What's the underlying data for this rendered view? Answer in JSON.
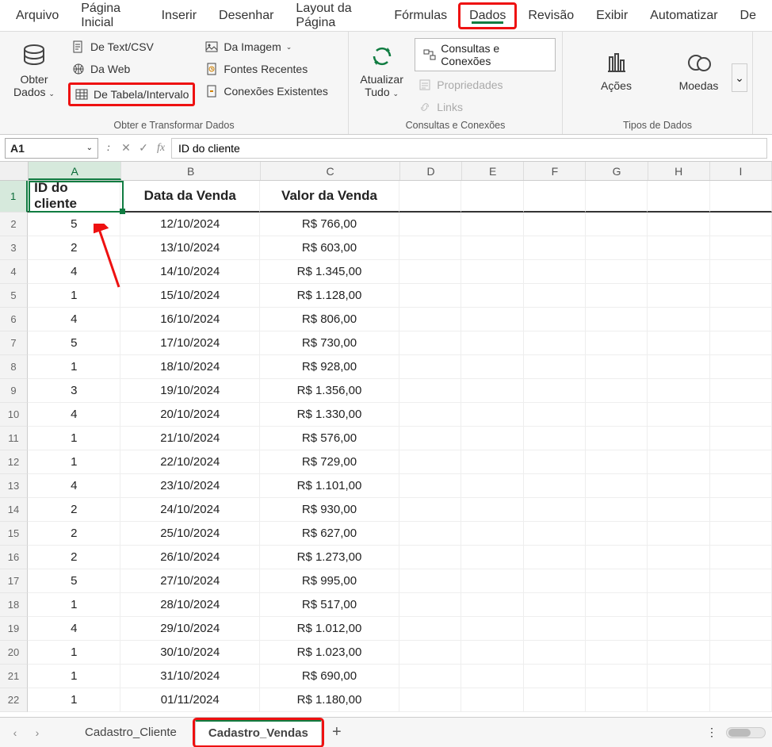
{
  "menu": {
    "tabs": [
      "Arquivo",
      "Página Inicial",
      "Inserir",
      "Desenhar",
      "Layout da Página",
      "Fórmulas",
      "Dados",
      "Revisão",
      "Exibir",
      "Automatizar",
      "De"
    ],
    "active": "Dados",
    "highlight": "Dados"
  },
  "ribbon": {
    "obter": {
      "big": "Obter\nDados",
      "textcsv": "De Text/CSV",
      "web": "Da Web",
      "tabela": "De Tabela/Intervalo",
      "imagem": "Da Imagem",
      "recentes": "Fontes Recentes",
      "conexoes": "Conexões Existentes",
      "group": "Obter e Transformar Dados"
    },
    "atualizar": {
      "big": "Atualizar\nTudo",
      "consultas": "Consultas e Conexões",
      "prop": "Propriedades",
      "links": "Links",
      "group": "Consultas e Conexões"
    },
    "tipos": {
      "acoes": "Ações",
      "moedas": "Moedas",
      "group": "Tipos de Dados"
    }
  },
  "formula": {
    "namebox": "A1",
    "value": "ID do cliente"
  },
  "columns": [
    "A",
    "B",
    "C",
    "D",
    "E",
    "F",
    "G",
    "H",
    "I"
  ],
  "colwidths": {
    "A": 120,
    "B": 180,
    "C": 180,
    "D": 80,
    "E": 80,
    "F": 80,
    "G": 80,
    "H": 80,
    "I": 80
  },
  "headers": [
    "ID do cliente",
    "Data da Venda",
    "Valor da Venda"
  ],
  "rows": [
    {
      "n": 1
    },
    {
      "n": 2,
      "a": "5",
      "b": "12/10/2024",
      "c": "R$ 766,00"
    },
    {
      "n": 3,
      "a": "2",
      "b": "13/10/2024",
      "c": "R$ 603,00"
    },
    {
      "n": 4,
      "a": "4",
      "b": "14/10/2024",
      "c": "R$ 1.345,00"
    },
    {
      "n": 5,
      "a": "1",
      "b": "15/10/2024",
      "c": "R$ 1.128,00"
    },
    {
      "n": 6,
      "a": "4",
      "b": "16/10/2024",
      "c": "R$ 806,00"
    },
    {
      "n": 7,
      "a": "5",
      "b": "17/10/2024",
      "c": "R$ 730,00"
    },
    {
      "n": 8,
      "a": "1",
      "b": "18/10/2024",
      "c": "R$ 928,00"
    },
    {
      "n": 9,
      "a": "3",
      "b": "19/10/2024",
      "c": "R$ 1.356,00"
    },
    {
      "n": 10,
      "a": "4",
      "b": "20/10/2024",
      "c": "R$ 1.330,00"
    },
    {
      "n": 11,
      "a": "1",
      "b": "21/10/2024",
      "c": "R$ 576,00"
    },
    {
      "n": 12,
      "a": "1",
      "b": "22/10/2024",
      "c": "R$ 729,00"
    },
    {
      "n": 13,
      "a": "4",
      "b": "23/10/2024",
      "c": "R$ 1.101,00"
    },
    {
      "n": 14,
      "a": "2",
      "b": "24/10/2024",
      "c": "R$ 930,00"
    },
    {
      "n": 15,
      "a": "2",
      "b": "25/10/2024",
      "c": "R$ 627,00"
    },
    {
      "n": 16,
      "a": "2",
      "b": "26/10/2024",
      "c": "R$ 1.273,00"
    },
    {
      "n": 17,
      "a": "5",
      "b": "27/10/2024",
      "c": "R$ 995,00"
    },
    {
      "n": 18,
      "a": "1",
      "b": "28/10/2024",
      "c": "R$ 517,00"
    },
    {
      "n": 19,
      "a": "4",
      "b": "29/10/2024",
      "c": "R$ 1.012,00"
    },
    {
      "n": 20,
      "a": "1",
      "b": "30/10/2024",
      "c": "R$ 1.023,00"
    },
    {
      "n": 21,
      "a": "1",
      "b": "31/10/2024",
      "c": "R$ 690,00"
    },
    {
      "n": 22,
      "a": "1",
      "b": "01/11/2024",
      "c": "R$ 1.180,00"
    }
  ],
  "sheets": {
    "tab1": "Cadastro_Cliente",
    "tab2": "Cadastro_Vendas"
  }
}
